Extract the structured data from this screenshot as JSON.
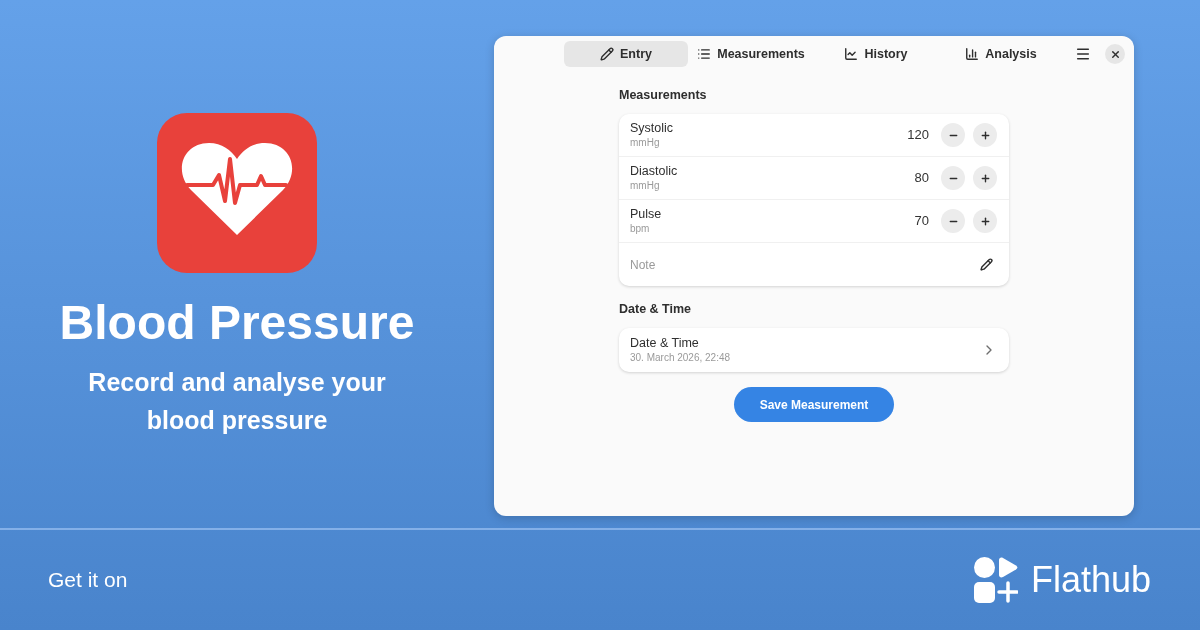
{
  "banner": {
    "title": "Blood Pressure",
    "subtitle": "Record and analyse your blood pressure"
  },
  "window": {
    "tabs": [
      {
        "label": "Entry",
        "selected": true
      },
      {
        "label": "Measurements",
        "selected": false
      },
      {
        "label": "History",
        "selected": false
      },
      {
        "label": "Analysis",
        "selected": false
      }
    ],
    "sections": [
      {
        "heading": "Measurements",
        "rows": [
          {
            "kind": "stepper",
            "label": "Systolic",
            "unit": "mmHg",
            "value": "120"
          },
          {
            "kind": "stepper",
            "label": "Diastolic",
            "unit": "mmHg",
            "value": "80"
          },
          {
            "kind": "stepper",
            "label": "Pulse",
            "unit": "bpm",
            "value": "70"
          },
          {
            "kind": "note",
            "placeholder": "Note"
          }
        ]
      },
      {
        "heading": "Date & Time",
        "rows": [
          {
            "kind": "link",
            "label": "Date & Time",
            "value": "30. March 2026, 22:48"
          }
        ]
      }
    ],
    "save_button": "Save Measurement"
  },
  "footer": {
    "cta": "Get it on",
    "store": "Flathub"
  }
}
